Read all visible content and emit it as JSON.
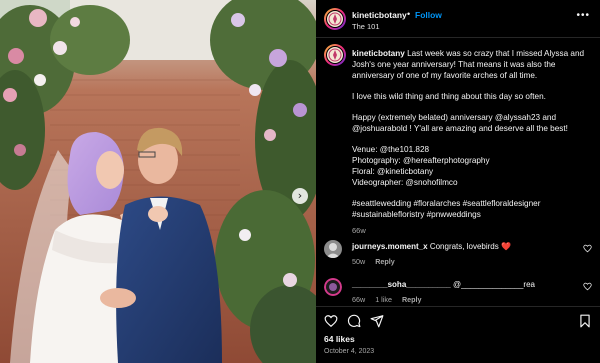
{
  "post": {
    "username": "kineticbotany",
    "follow_label": "Follow",
    "dot": "•",
    "location": "The 101",
    "more_label": "•••"
  },
  "caption": {
    "username": "kineticbotany",
    "line1": "Last week was so crazy that I missed Alyssa and Josh's one year anniversary! That means it was also the anniversary of one of my favorite arches of all time.",
    "line2": "I love this wild thing and thing about this day so often.",
    "line3": "Happy (extremely belated) anniversary @alyssah23 and @joshuarabold ! Y'all are amazing and deserve all the best!",
    "venue": "Venue: @the101.828",
    "photography": "Photography: @hereafterphotography",
    "floral": "Floral: @kineticbotany",
    "videographer": "Videographer: @snohofilmco",
    "hashtags": "#seattlewedding #floralarches #seattlefloraldesigner #sustainablefloristry #pnwweddings",
    "time": "66w"
  },
  "comments": [
    {
      "username": "journeys.moment_x",
      "text": "Congrats, lovebirds ❤️",
      "time": "50w",
      "likes": "",
      "reply": "Reply"
    },
    {
      "username": "________soha__________",
      "text": "@______________rea",
      "time": "66w",
      "likes": "1 like",
      "reply": "Reply"
    }
  ],
  "icons": {
    "like": "heart-icon",
    "comment": "comment-icon",
    "share": "share-icon",
    "save": "bookmark-icon",
    "next": "chevron-right-icon"
  },
  "next_glyph": "›",
  "stats": {
    "likes": "64 likes",
    "date": "October 4, 2023"
  },
  "colors": {
    "background": "#000000",
    "link_blue": "#0095f6",
    "muted_text": "#a8a8a8"
  }
}
